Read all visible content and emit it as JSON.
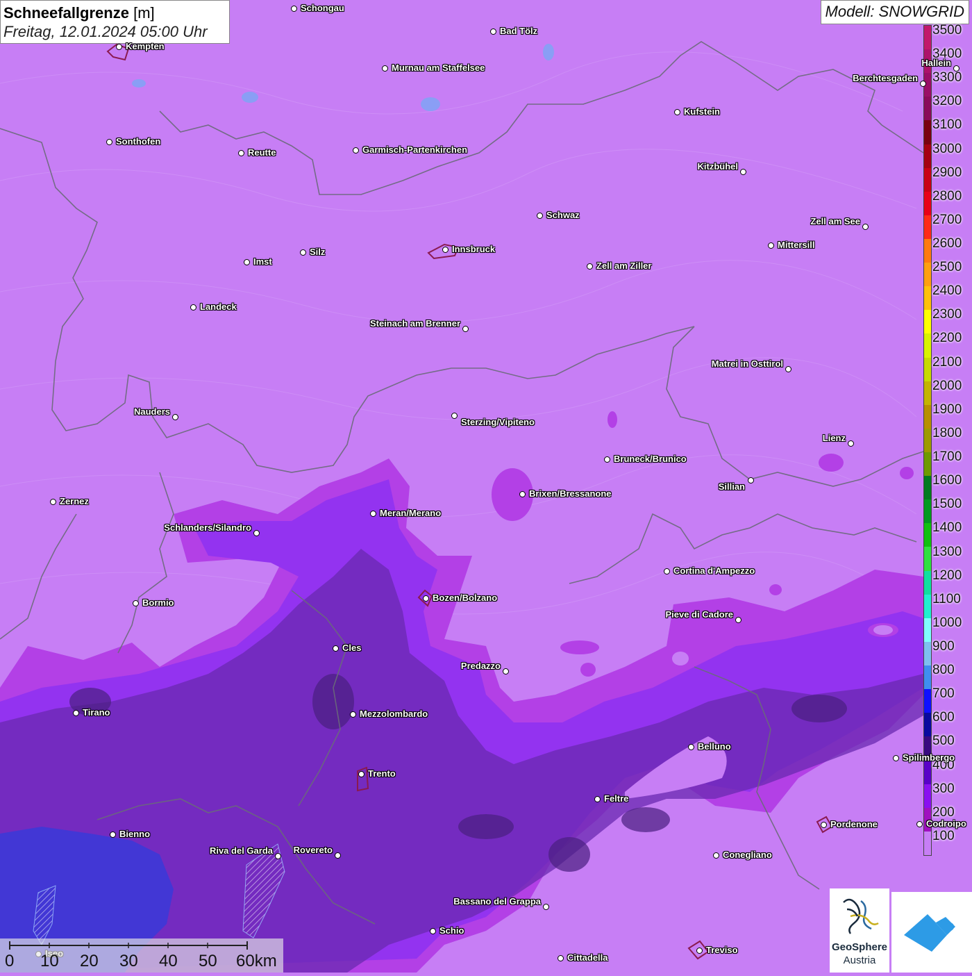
{
  "header": {
    "title_bold": "Schneefallgrenze",
    "title_unit": "[m]",
    "datetime": "Freitag, 12.01.2024 05:00 Uhr",
    "model": "Modell: SNOWGRID"
  },
  "legend": {
    "entries": [
      {
        "label": "3500",
        "color": "#c2186b"
      },
      {
        "label": "3400",
        "color": "#ad126a"
      },
      {
        "label": "3300",
        "color": "#9a0e66"
      },
      {
        "label": "3200",
        "color": "#8a0b5a"
      },
      {
        "label": "3100",
        "color": "#7a0010"
      },
      {
        "label": "3000",
        "color": "#a50012"
      },
      {
        "label": "2900",
        "color": "#c90014"
      },
      {
        "label": "2800",
        "color": "#e8001a"
      },
      {
        "label": "2700",
        "color": "#ff2a1a"
      },
      {
        "label": "2600",
        "color": "#ff7a10"
      },
      {
        "label": "2500",
        "color": "#ff9f10"
      },
      {
        "label": "2400",
        "color": "#ffc00a"
      },
      {
        "label": "2300",
        "color": "#ffff00"
      },
      {
        "label": "2200",
        "color": "#d9f200"
      },
      {
        "label": "2100",
        "color": "#c8da00"
      },
      {
        "label": "2000",
        "color": "#c4b400"
      },
      {
        "label": "1900",
        "color": "#b88f00"
      },
      {
        "label": "1800",
        "color": "#9e9a00"
      },
      {
        "label": "1700",
        "color": "#6e9a00"
      },
      {
        "label": "1600",
        "color": "#007a20"
      },
      {
        "label": "1500",
        "color": "#009a20"
      },
      {
        "label": "1400",
        "color": "#10c010"
      },
      {
        "label": "1300",
        "color": "#30e040"
      },
      {
        "label": "1200",
        "color": "#10e0a0"
      },
      {
        "label": "1100",
        "color": "#20f0d0"
      },
      {
        "label": "1000",
        "color": "#80ffff"
      },
      {
        "label": "900",
        "color": "#7ec0f0"
      },
      {
        "label": "800",
        "color": "#3f8ef0"
      },
      {
        "label": "700",
        "color": "#1010ff"
      },
      {
        "label": "600",
        "color": "#0a0aa0"
      },
      {
        "label": "500",
        "color": "#380a80"
      },
      {
        "label": "400",
        "color": "#5a00c8"
      },
      {
        "label": "300",
        "color": "#8a10f0"
      },
      {
        "label": "200",
        "color": "#a010c0"
      },
      {
        "label": "100",
        "color": "#c77ef5"
      }
    ]
  },
  "cities": [
    {
      "name": "Schongau"
    },
    {
      "name": "Bad Tölz"
    },
    {
      "name": "Kempten"
    },
    {
      "name": "Murnau am Staffelsee"
    },
    {
      "name": "Hallein"
    },
    {
      "name": "Berchtesgaden"
    },
    {
      "name": "Kufstein"
    },
    {
      "name": "Sonthofen"
    },
    {
      "name": "Reutte"
    },
    {
      "name": "Garmisch-Partenkirchen"
    },
    {
      "name": "Kitzbühel"
    },
    {
      "name": "Schwaz"
    },
    {
      "name": "Zell am See"
    },
    {
      "name": "Innsbruck"
    },
    {
      "name": "Mittersill"
    },
    {
      "name": "Imst"
    },
    {
      "name": "Silz"
    },
    {
      "name": "Zell am Ziller"
    },
    {
      "name": "Landeck"
    },
    {
      "name": "Steinach am Brenner"
    },
    {
      "name": "Matrei in Osttirol"
    },
    {
      "name": "Nauders"
    },
    {
      "name": "Sterzing/Vipiteno"
    },
    {
      "name": "Lienz"
    },
    {
      "name": "Bruneck/Brunico"
    },
    {
      "name": "Sillian"
    },
    {
      "name": "Zernez"
    },
    {
      "name": "Brixen/Bressanone"
    },
    {
      "name": "Meran/Merano"
    },
    {
      "name": "Schlanders/Silandro"
    },
    {
      "name": "Cortina d'Ampezzo"
    },
    {
      "name": "Bozen/Bolzano"
    },
    {
      "name": "Bormio"
    },
    {
      "name": "Pieve di Cadore"
    },
    {
      "name": "Cles"
    },
    {
      "name": "Predazzo"
    },
    {
      "name": "Tirano"
    },
    {
      "name": "Mezzolombardo"
    },
    {
      "name": "Belluno"
    },
    {
      "name": "Spilimbergo"
    },
    {
      "name": "Trento"
    },
    {
      "name": "Feltre"
    },
    {
      "name": "Pordenone"
    },
    {
      "name": "Codroipo"
    },
    {
      "name": "Bienno"
    },
    {
      "name": "Riva del Garda"
    },
    {
      "name": "Rovereto"
    },
    {
      "name": "Conegliano"
    },
    {
      "name": "Bassano del Grappa"
    },
    {
      "name": "Schio"
    },
    {
      "name": "Treviso"
    },
    {
      "name": "Cittadella"
    },
    {
      "name": "Iseo"
    }
  ],
  "scalebar": {
    "ticks": [
      "0",
      "10",
      "20",
      "30",
      "40",
      "50",
      "60km"
    ]
  },
  "logos": {
    "geosphere_line1": "GeoSphere",
    "geosphere_line2": "Austria"
  }
}
